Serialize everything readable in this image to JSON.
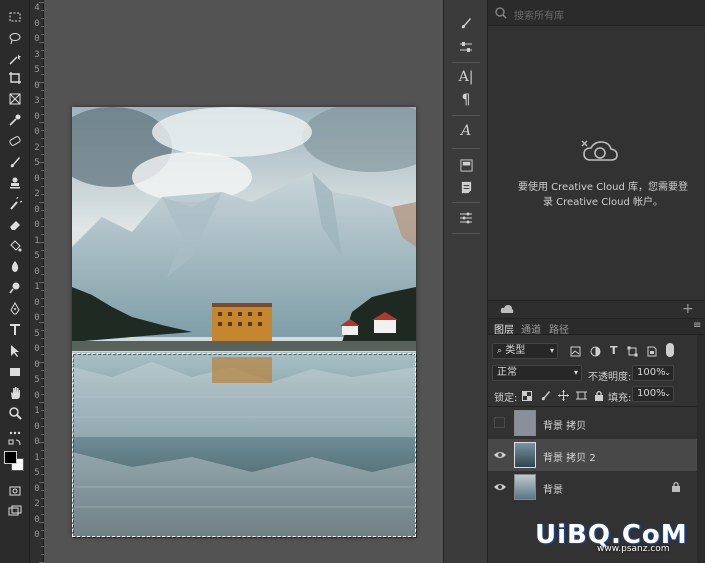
{
  "colors": {
    "accent": "#1f4fa3",
    "panel": "#323232",
    "toolbar": "#2b2b2b"
  },
  "ruler": {
    "labels": [
      "4",
      "0",
      "0",
      "3",
      "5",
      "0",
      "3",
      "0",
      "0",
      "2",
      "5",
      "0",
      "2",
      "0",
      "0",
      "1",
      "5",
      "0",
      "1",
      "0",
      "0",
      "5",
      "0",
      "0",
      "5",
      "0",
      "1",
      "0",
      "0",
      "1",
      "5",
      "0",
      "2",
      "0",
      "0"
    ]
  },
  "tools": [
    "move-icon",
    "marquee-icon",
    "lasso-icon",
    "magic-wand-icon",
    "crop-icon",
    "frame-icon",
    "eyedropper-icon",
    "healing-brush-icon",
    "brush-icon",
    "stamp-icon",
    "history-brush-icon",
    "eraser-icon",
    "bucket-icon",
    "blur-icon",
    "dodge-icon",
    "pen-icon",
    "type-icon",
    "path-select-icon",
    "rectangle-icon",
    "hand-icon",
    "zoom-icon",
    "more-icon",
    "swap-colors-icon",
    "foreground-color-swatch",
    "quick-mask-icon",
    "screen-mode-icon"
  ],
  "libraries": {
    "search_placeholder": "搜索所有库",
    "message_line1": "要使用 Creative Cloud 库，您需要登",
    "message_line2": "录 Creative Cloud 帐户。"
  },
  "layers_panel": {
    "tabs": [
      "图层",
      "通道",
      "路径"
    ],
    "filter_kind": "类型",
    "blend_mode": "正常",
    "opacity_label": "不透明度:",
    "opacity_value": "100%",
    "lock_label": "锁定:",
    "fill_label": "填充:",
    "fill_value": "100%",
    "layers": [
      {
        "name": "背景 拷贝",
        "visible": false,
        "selected": false,
        "locked": false
      },
      {
        "name": "背景 拷贝 2",
        "visible": true,
        "selected": true,
        "locked": false
      },
      {
        "name": "背景",
        "visible": true,
        "selected": false,
        "locked": true
      }
    ]
  },
  "watermark": {
    "main": "UiBQ.CoM",
    "sub": "www.psanz.com"
  }
}
